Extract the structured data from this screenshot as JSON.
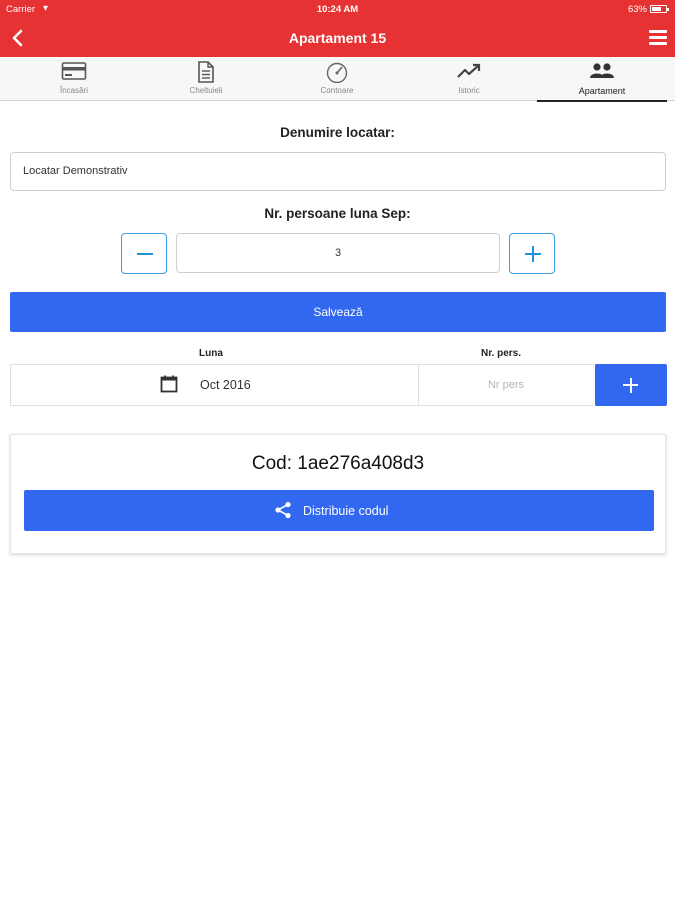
{
  "status_bar": {
    "carrier": "Carrier",
    "time": "10:24 AM",
    "battery": "63%",
    "battery_level": 0.63
  },
  "nav": {
    "title": "Apartament 15",
    "back_icon": "chevron-left-icon",
    "menu_icon": "hamburger-menu-icon"
  },
  "tabs": [
    {
      "label": "Încasări",
      "icon": "credit-card-icon"
    },
    {
      "label": "Cheltuieli",
      "icon": "document-icon"
    },
    {
      "label": "Contoare",
      "icon": "gauge-icon"
    },
    {
      "label": "Istoric",
      "icon": "trend-up-icon"
    },
    {
      "label": "Apartament",
      "icon": "people-icon",
      "active": true
    }
  ],
  "form": {
    "tenant_label": "Denumire locatar:",
    "tenant_value": "Locatar Demonstrativ",
    "persons_label": "Nr. persoane luna Sep:",
    "persons_value": "3",
    "save_label": "Salvează"
  },
  "month_row": {
    "col_month": "Luna",
    "col_persons": "Nr. pers.",
    "month_value": "Oct 2016",
    "persons_placeholder": "Nr pers"
  },
  "code_card": {
    "code_text": "Cod: 1ae276a408d3",
    "share_label": "Distribuie codul"
  },
  "colors": {
    "header_red": "#e63232",
    "primary_blue": "#3268f0",
    "stepper_blue": "#1f8fd6"
  }
}
